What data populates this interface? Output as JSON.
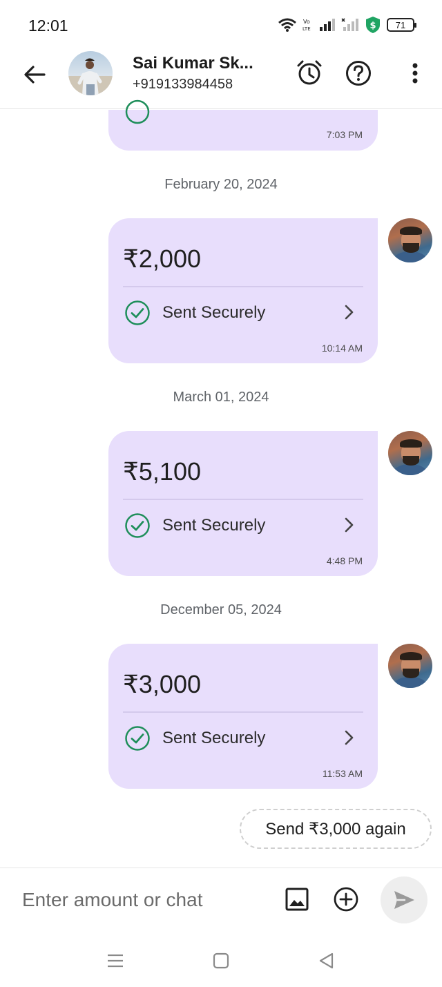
{
  "status_bar": {
    "time": "12:01",
    "battery_level": "71",
    "icons": [
      "wifi-icon",
      "volte-icon",
      "signal-icon",
      "signal-no-service-icon",
      "shield-dollar-icon",
      "battery-icon"
    ]
  },
  "header": {
    "contact_name": "Sai Kumar Sk...",
    "contact_phone": "+919133984458",
    "icons": [
      "back-arrow-icon",
      "alarm-clock-icon",
      "help-icon",
      "more-vert-icon"
    ]
  },
  "conversation": {
    "top_partial": {
      "time": "7:03 PM"
    },
    "payments": [
      {
        "date": "February 20, 2024",
        "amount": "₹2,000",
        "status": "Sent Securely",
        "time": "10:14 AM"
      },
      {
        "date": "March 01, 2024",
        "amount": "₹5,100",
        "status": "Sent Securely",
        "time": "4:48 PM"
      },
      {
        "date": "December 05, 2024",
        "amount": "₹3,000",
        "status": "Sent Securely",
        "time": "11:53 AM"
      }
    ],
    "suggestion": "Send ₹3,000 again"
  },
  "input_bar": {
    "placeholder": "Enter amount or chat",
    "icons": [
      "image-icon",
      "add-circle-icon",
      "send-icon"
    ]
  },
  "nav_bar": {
    "icons": [
      "menu-icon",
      "home-square-icon",
      "back-triangle-icon"
    ]
  },
  "colors": {
    "bubble": "#e8defc",
    "check_green": "#1e8e5a",
    "shield_green": "#1fa463"
  }
}
